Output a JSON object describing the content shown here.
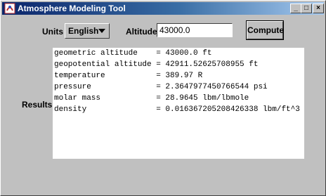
{
  "window": {
    "title": "Atmosphere Modeling Tool",
    "controls": {
      "minimize": "_",
      "maximize": "□",
      "close": "×"
    }
  },
  "form": {
    "units_label": "Units",
    "units_value": "English",
    "altitude_label": "Altitude",
    "altitude_value": "43000.0",
    "compute_label": "Compute"
  },
  "results": {
    "label": "Results",
    "lines": [
      "geometric altitude    = 43000.0 ft",
      "geopotential altitude = 42911.52625708955 ft",
      "temperature           = 389.97 R",
      "pressure              = 2.3647977450766544 psi",
      "molar mass            = 28.9645 lbm/lbmole",
      "density               = 0.016367205208426338 lbm/ft^3"
    ]
  },
  "colors": {
    "titlebar_start": "#0a246a",
    "titlebar_end": "#a6caf0",
    "window_bg": "#c0c0c0",
    "results_bg": "#ffffff"
  },
  "icons": {
    "app": "app-icon",
    "dropdown": "chevron-down-icon"
  }
}
